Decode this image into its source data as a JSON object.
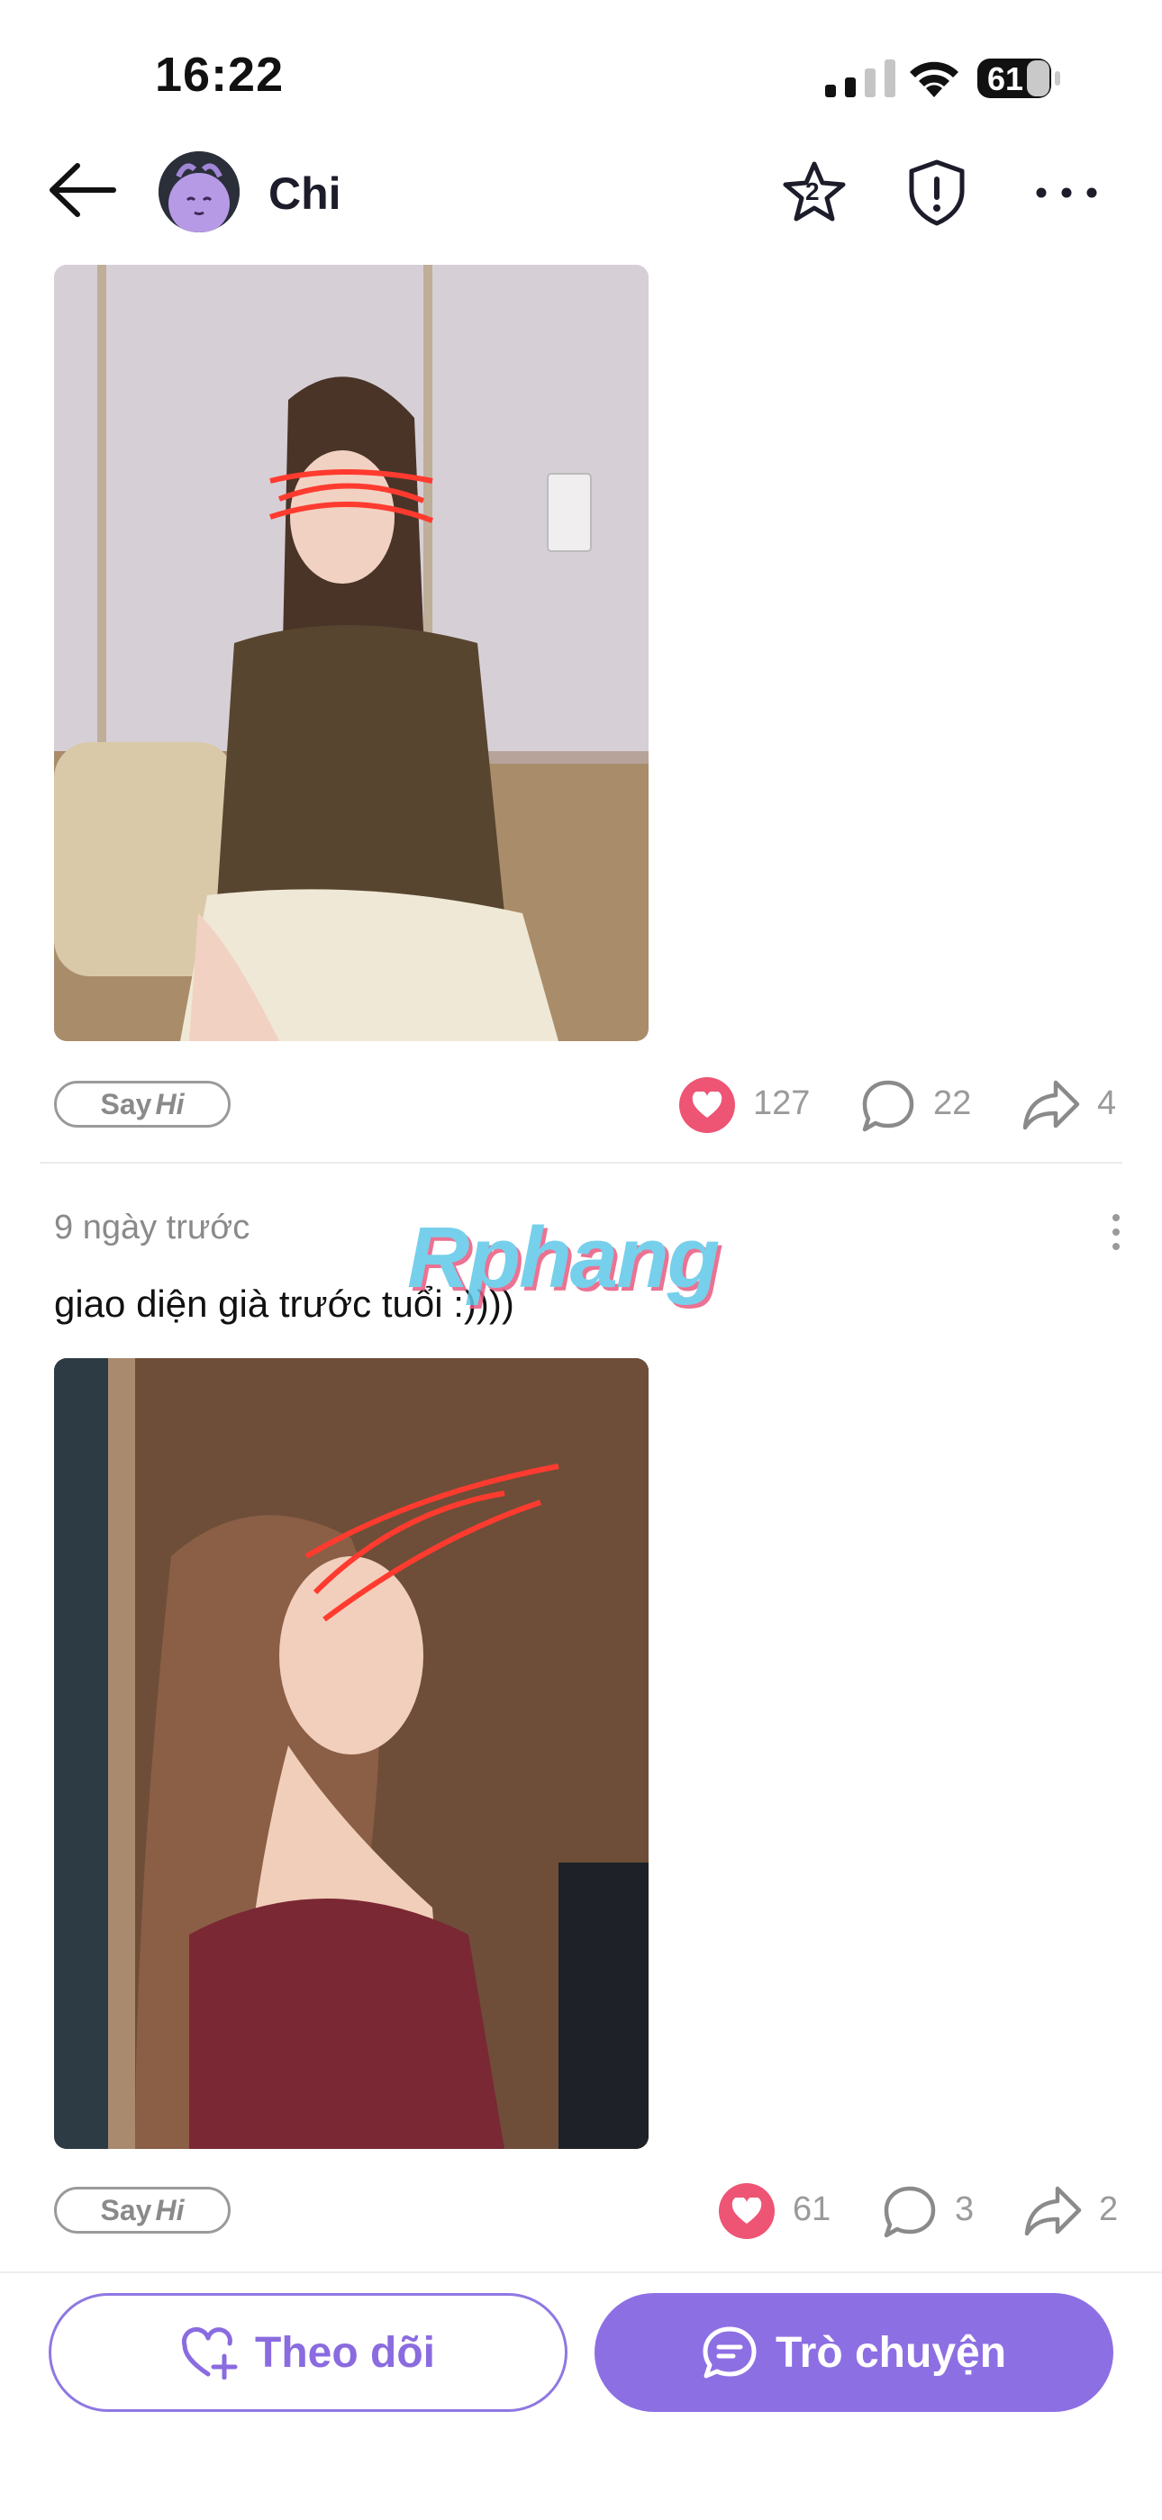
{
  "status_bar": {
    "time": "16:22",
    "battery": "61"
  },
  "header": {
    "username": "Chi",
    "star_badge": "2"
  },
  "posts": [
    {
      "sayhi_prefix": "Say",
      "sayhi_suffix": "Hi",
      "likes": "127",
      "comments": "22",
      "shares": "4"
    },
    {
      "time": "9 ngày trước",
      "caption": "giao diện già trước tuổi :))))",
      "sayhi_prefix": "Say",
      "sayhi_suffix": "Hi",
      "likes": "61",
      "comments": "3",
      "shares": "2"
    }
  ],
  "watermark": "Rphang",
  "bottom_bar": {
    "follow_label": "Theo dõi",
    "chat_label": "Trò chuyện"
  },
  "colors": {
    "accent": "#8d6fe4",
    "like": "#ee5474",
    "muted": "#9a9a9a"
  }
}
